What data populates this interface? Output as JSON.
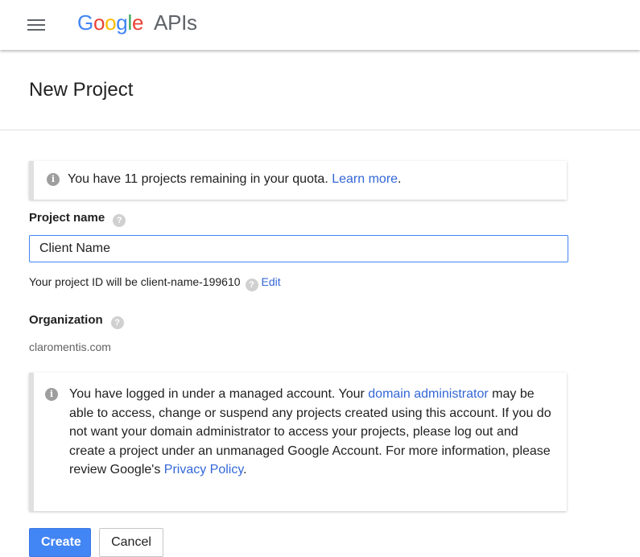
{
  "header": {
    "logo_letters": [
      {
        "ch": "G",
        "color": "#4285F4"
      },
      {
        "ch": "o",
        "color": "#EA4335"
      },
      {
        "ch": "o",
        "color": "#FBBC05"
      },
      {
        "ch": "g",
        "color": "#4285F4"
      },
      {
        "ch": "l",
        "color": "#34A853"
      },
      {
        "ch": "e",
        "color": "#EA4335"
      }
    ],
    "product": "APIs"
  },
  "page": {
    "title": "New Project"
  },
  "quota_notice": {
    "text": "You have 11 projects remaining in your quota.",
    "link": "Learn more",
    "suffix": "."
  },
  "project_name": {
    "label": "Project name",
    "value": "Client Name",
    "id_prefix": "Your project ID will be",
    "id_value": "client-name-199610",
    "edit_link": "Edit"
  },
  "organization": {
    "label": "Organization",
    "value": "claromentis.com"
  },
  "managed_notice": {
    "part1": "You have logged in under a managed account. Your",
    "link1": "domain administrator",
    "part2": "may be able to access, change or suspend any projects created using this account. If you do not want your domain administrator to access your projects, please log out and create a project under an unmanaged Google Account. For more information, please review Google's",
    "link2": "Privacy Policy",
    "suffix": "."
  },
  "actions": {
    "create": "Create",
    "cancel": "Cancel"
  },
  "colors": {
    "accent": "#4285F4",
    "link": "#3367D6"
  }
}
